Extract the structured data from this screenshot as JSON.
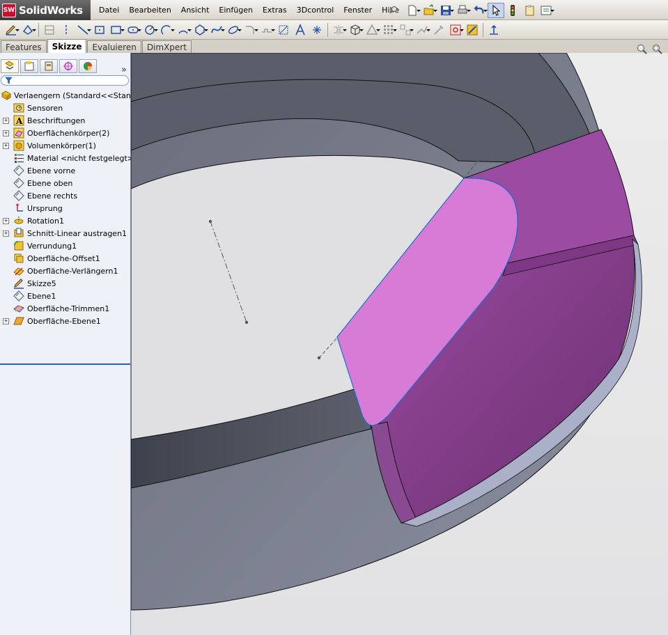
{
  "app": {
    "name": "SolidWorks",
    "logo_letters": "SW"
  },
  "menu": [
    "Datei",
    "Bearbeiten",
    "Ansicht",
    "Einfügen",
    "Extras",
    "3Dcontrol",
    "Fenster",
    "Hilfe"
  ],
  "tabs": [
    "Features",
    "Skizze",
    "Evaluieren",
    "DimXpert"
  ],
  "active_tab": "Skizze",
  "feature_tree": {
    "root": "Verlaengern  (Standard<<Standar",
    "items": [
      {
        "label": "Sensoren",
        "icon": "sensor-icon",
        "expandable": false
      },
      {
        "label": "Beschriftungen",
        "icon": "annotation-icon",
        "expandable": true
      },
      {
        "label": "Oberflächenkörper(2)",
        "icon": "surface-bodies-icon",
        "expandable": true
      },
      {
        "label": "Volumenkörper(1)",
        "icon": "solid-bodies-icon",
        "expandable": true
      },
      {
        "label": "Material <nicht festgelegt>",
        "icon": "material-icon",
        "expandable": false
      },
      {
        "label": "Ebene vorne",
        "icon": "plane-icon",
        "expandable": false
      },
      {
        "label": "Ebene oben",
        "icon": "plane-icon",
        "expandable": false
      },
      {
        "label": "Ebene rechts",
        "icon": "plane-icon",
        "expandable": false
      },
      {
        "label": "Ursprung",
        "icon": "origin-icon",
        "expandable": false
      },
      {
        "label": "Rotation1",
        "icon": "revolve-icon",
        "expandable": true
      },
      {
        "label": "Schnitt-Linear austragen1",
        "icon": "cut-extrude-icon",
        "expandable": true
      },
      {
        "label": "Verrundung1",
        "icon": "fillet-icon",
        "expandable": false
      },
      {
        "label": "Oberfläche-Offset1",
        "icon": "offset-surface-icon",
        "expandable": false
      },
      {
        "label": "Oberfläche-Verlängern1",
        "icon": "extend-surface-icon",
        "expandable": false
      },
      {
        "label": "Skizze5",
        "icon": "sketch-icon",
        "expandable": false
      },
      {
        "label": "Ebene1",
        "icon": "plane-icon",
        "expandable": false
      },
      {
        "label": "Oberfläche-Trimmen1",
        "icon": "trim-surface-icon",
        "expandable": false
      },
      {
        "label": "Oberfläche-Ebene1",
        "icon": "planar-surface-icon",
        "expandable": true
      }
    ]
  },
  "colors": {
    "model_gray": "#6b7080",
    "model_top": "#575b68",
    "surface_magenta": "#d77bd6",
    "surface_dark": "#7a3a7e",
    "panel_bg": "#eef1f7"
  }
}
